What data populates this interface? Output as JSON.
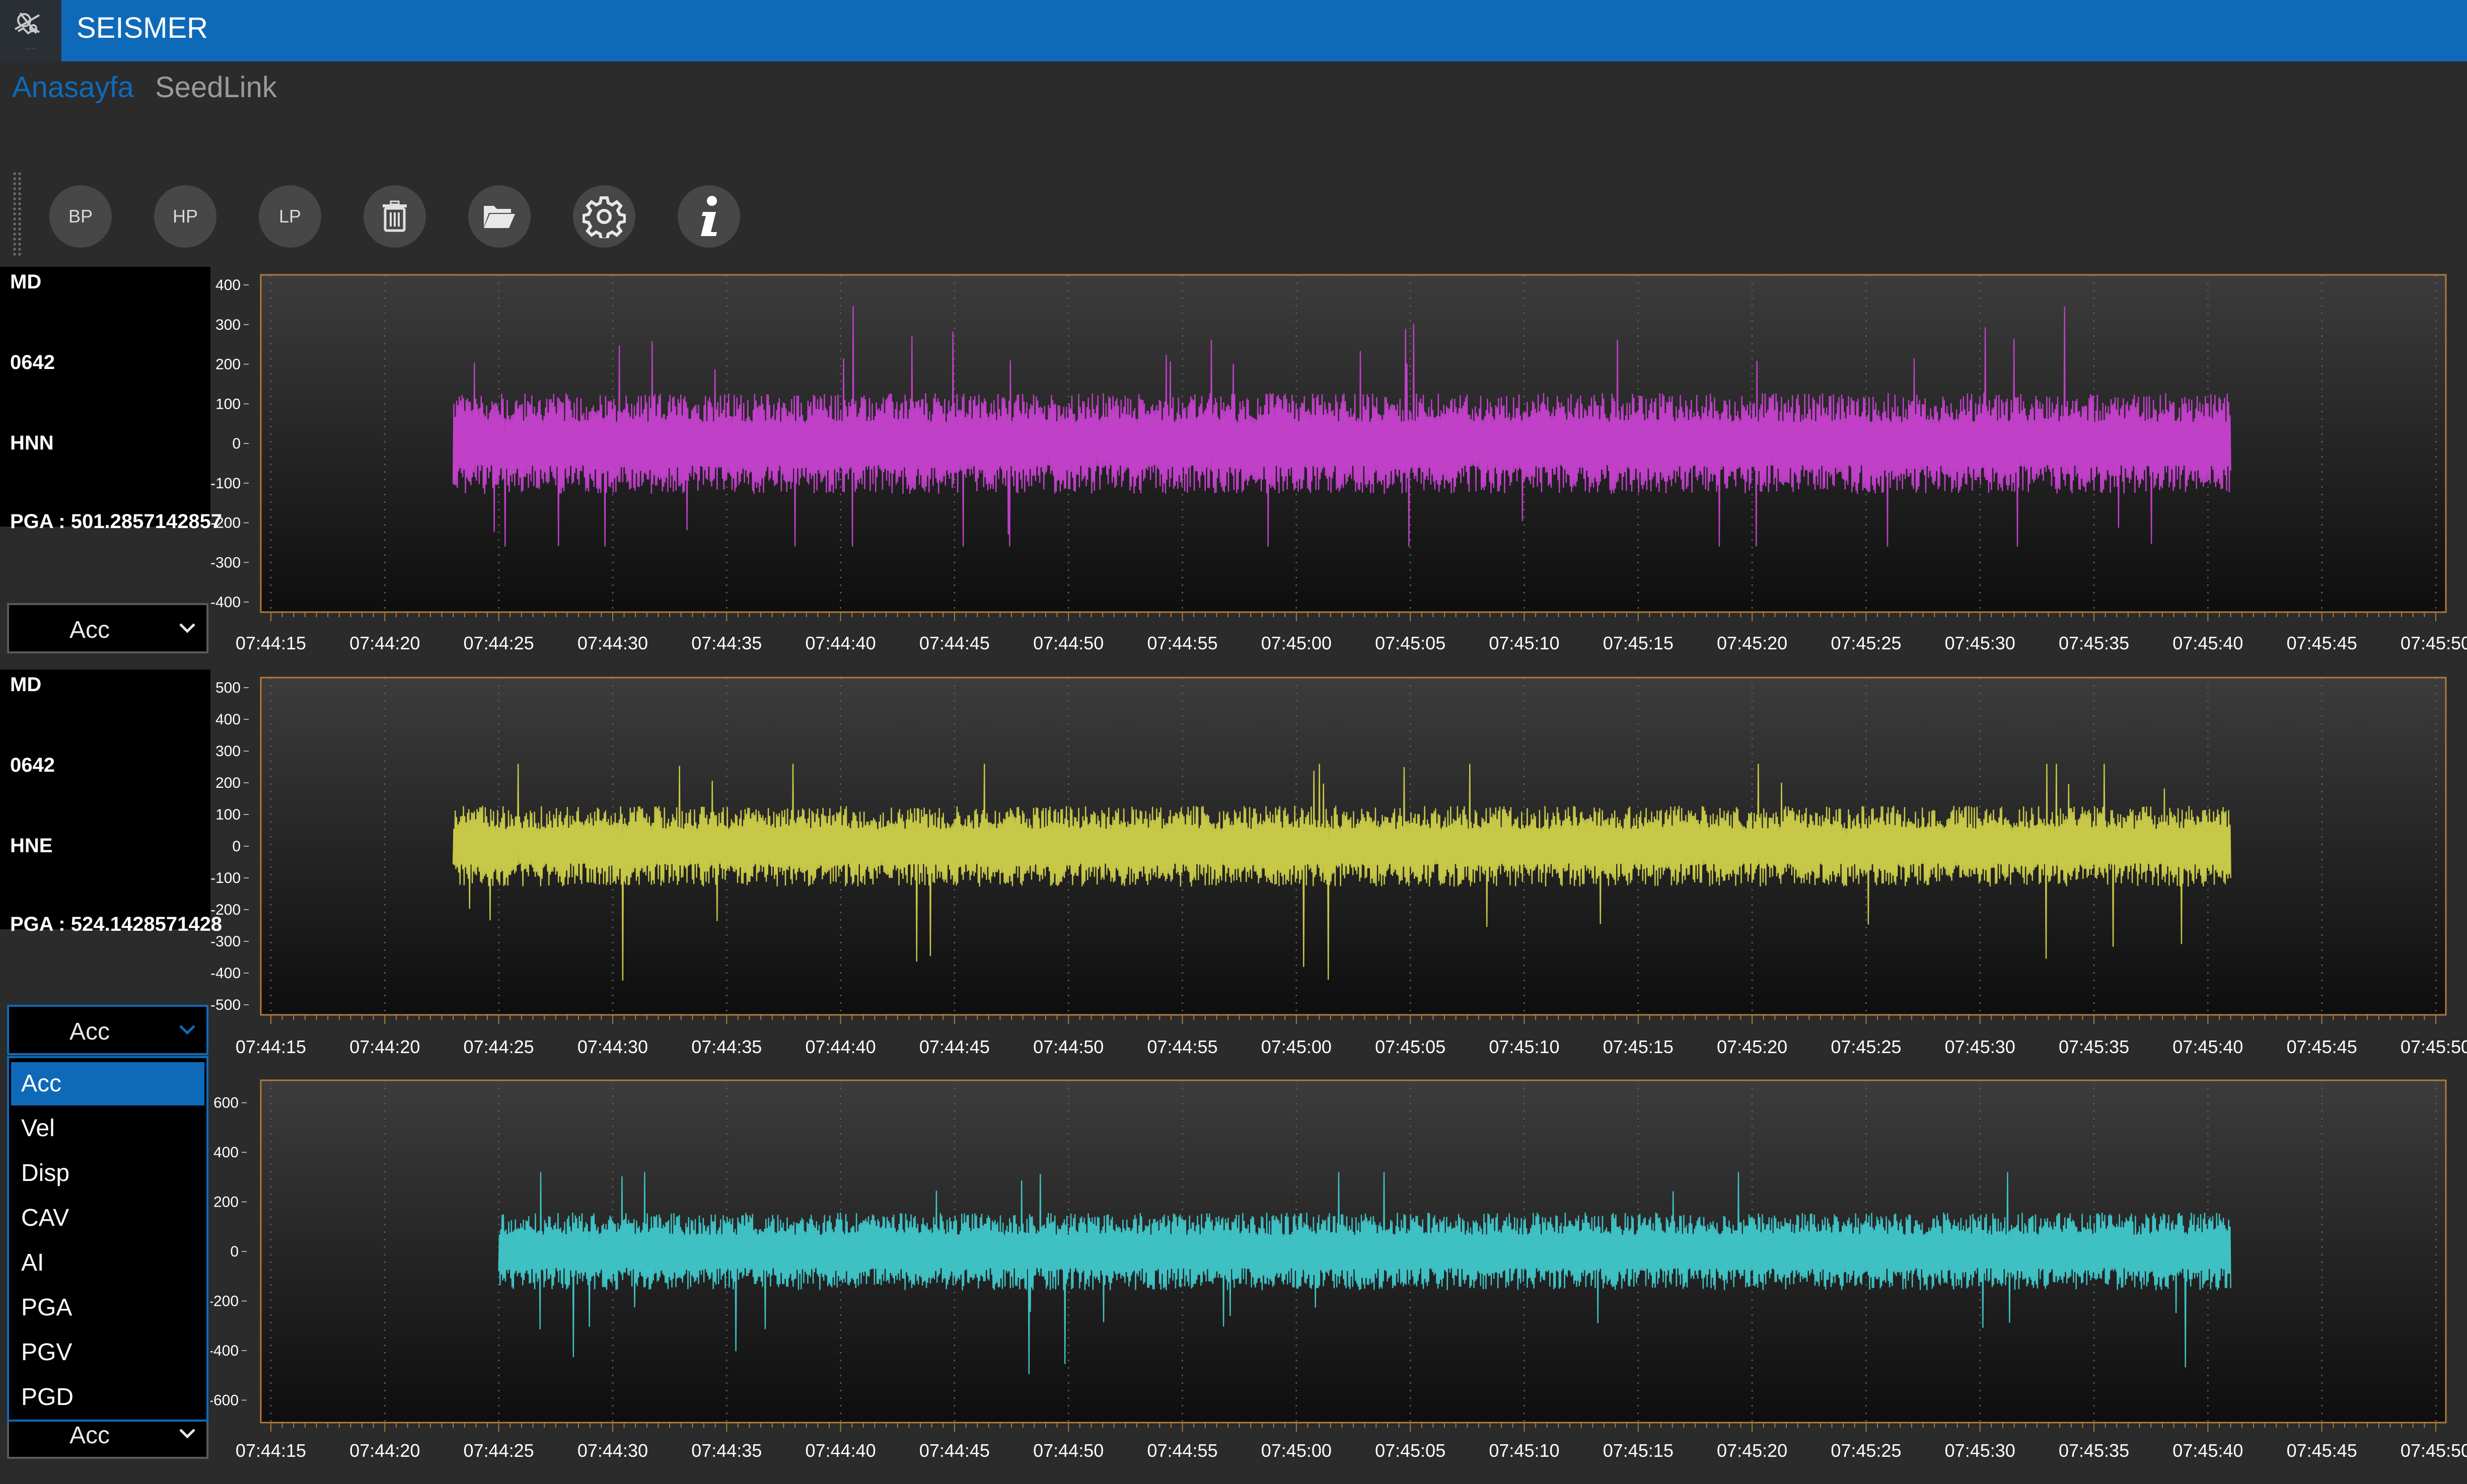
{
  "app": {
    "title": "SEISMER",
    "logo_icon": "seismer-logo-icon"
  },
  "nav": {
    "tabs": [
      {
        "label": "Anasayfa",
        "active": true
      },
      {
        "label": "SeedLink",
        "active": false
      }
    ]
  },
  "toolbar": {
    "buttons": [
      {
        "label": "BP",
        "name": "bp-filter-button"
      },
      {
        "label": "HP",
        "name": "hp-filter-button"
      },
      {
        "label": "LP",
        "name": "lp-filter-button"
      },
      {
        "icon": "trash-icon",
        "name": "delete-button"
      },
      {
        "icon": "folder-open-icon",
        "name": "open-folder-button"
      },
      {
        "icon": "gear-icon",
        "name": "settings-button"
      },
      {
        "icon": "info-icon",
        "name": "info-button"
      }
    ]
  },
  "channels": [
    {
      "network": "MD",
      "station": "0642",
      "channel": "HNN",
      "pga": "PGA : 501.2857142857",
      "mode": "Acc"
    },
    {
      "network": "MD",
      "station": "0642",
      "channel": "HNE",
      "pga": "PGA : 524.1428571428",
      "mode": "Acc"
    },
    {
      "mode": "Acc"
    }
  ],
  "dropdown": {
    "options": [
      "Acc",
      "Vel",
      "Disp",
      "CAV",
      "AI",
      "PGA",
      "PGV",
      "PGD"
    ],
    "selected": "Acc"
  },
  "colors": {
    "titlebar": "#0e6ab9",
    "accent": "#0e6ab9",
    "nav_inactive": "#9a9a9a",
    "trace_hnn": "#c040c8",
    "trace_hne": "#c8c848",
    "trace_3": "#3fc1c4"
  },
  "chart_data": [
    {
      "type": "line",
      "title": "",
      "series": [
        {
          "name": "HNN",
          "amplitude_range": [
            -260,
            350
          ]
        }
      ],
      "x": [
        "07:44:15",
        "07:44:20",
        "07:44:25",
        "07:44:30",
        "07:44:35",
        "07:44:40",
        "07:44:45",
        "07:44:50",
        "07:44:55",
        "07:45:00",
        "07:45:05",
        "07:45:10",
        "07:45:15",
        "07:45:20",
        "07:45:25",
        "07:45:30",
        "07:45:35",
        "07:45:40",
        "07:45:45",
        "07:45:50"
      ],
      "yticks": [
        400,
        300,
        200,
        100,
        0,
        -100,
        -200,
        -300,
        -400
      ],
      "ylim": [
        -400,
        400
      ],
      "xlim": [
        "07:44:15",
        "07:45:50"
      ],
      "data_span": [
        "07:44:23",
        "07:45:41"
      ],
      "grid": "vertical dotted"
    },
    {
      "type": "line",
      "title": "",
      "series": [
        {
          "name": "HNE",
          "amplitude_range": [
            -440,
            260
          ]
        }
      ],
      "x": [
        "07:44:15",
        "07:44:20",
        "07:44:25",
        "07:44:30",
        "07:44:35",
        "07:44:40",
        "07:44:45",
        "07:44:50",
        "07:44:55",
        "07:45:00",
        "07:45:05",
        "07:45:10",
        "07:45:15",
        "07:45:20",
        "07:45:25",
        "07:45:30",
        "07:45:35",
        "07:45:40",
        "07:45:45",
        "07:45:50"
      ],
      "yticks": [
        500,
        400,
        300,
        200,
        100,
        0,
        -100,
        -200,
        -300,
        -400,
        -500
      ],
      "ylim": [
        -500,
        500
      ],
      "xlim": [
        "07:44:15",
        "07:45:50"
      ],
      "data_span": [
        "07:44:23",
        "07:45:41"
      ],
      "grid": "vertical dotted"
    },
    {
      "type": "line",
      "title": "",
      "series": [
        {
          "amplitude_range": [
            -540,
            320
          ]
        }
      ],
      "x": [
        "07:44:15",
        "07:44:20",
        "07:44:25",
        "07:44:30",
        "07:44:35",
        "07:44:40",
        "07:44:45",
        "07:44:50",
        "07:44:55",
        "07:45:00",
        "07:45:05",
        "07:45:10",
        "07:45:15",
        "07:45:20",
        "07:45:25",
        "07:45:30",
        "07:45:35",
        "07:45:40",
        "07:45:45",
        "07:45:50"
      ],
      "yticks": [
        600,
        400,
        200,
        0,
        -200,
        -400,
        -600
      ],
      "ylim": [
        -650,
        650
      ],
      "xlim": [
        "07:44:15",
        "07:45:50"
      ],
      "data_span": [
        "07:44:25",
        "07:45:41"
      ],
      "grid": "vertical dotted"
    }
  ]
}
